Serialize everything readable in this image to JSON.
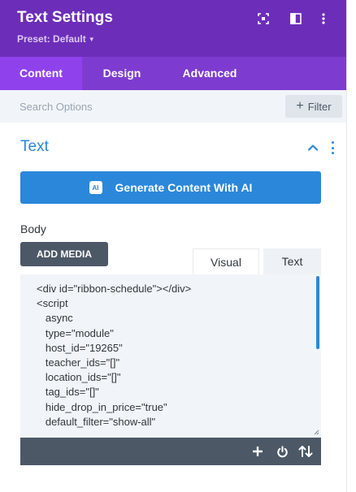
{
  "header": {
    "title": "Text Settings",
    "preset_label": "Preset: Default",
    "icons": [
      "expand-icon",
      "sidebar-layout-icon",
      "more-vertical-icon"
    ]
  },
  "tabs": [
    {
      "label": "Content",
      "active": true
    },
    {
      "label": "Design",
      "active": false
    },
    {
      "label": "Advanced",
      "active": false
    }
  ],
  "search": {
    "placeholder": "Search Options",
    "value": "",
    "filter_label": "Filter"
  },
  "section": {
    "title": "Text",
    "expanded": true
  },
  "ai_button": {
    "badge": "AI",
    "label": "Generate Content With AI"
  },
  "body_field": {
    "label": "Body",
    "add_media_label": "ADD MEDIA",
    "editor_tabs": [
      "Visual",
      "Text"
    ],
    "code_lines": [
      "<div id=\"ribbon-schedule\"></div>",
      "<script",
      "   async",
      "   type=\"module\"",
      "   host_id=\"19265\"",
      "   teacher_ids=\"[]\"",
      "   location_ids=\"[]\"",
      "   tag_ids=\"[]\"",
      "   hide_drop_in_price=\"true\"",
      "   default_filter=\"show-all\""
    ],
    "footer_icons": [
      "plus-icon",
      "power-icon",
      "sort-arrows-icon"
    ]
  },
  "colors": {
    "header_bg": "#6c2eb9",
    "tabs_bg": "#7e3bd0",
    "active_tab_bg": "#8f42ec",
    "accent_blue": "#2b87da",
    "dark_button": "#4c5866",
    "field_bg": "#f1f5f9"
  }
}
